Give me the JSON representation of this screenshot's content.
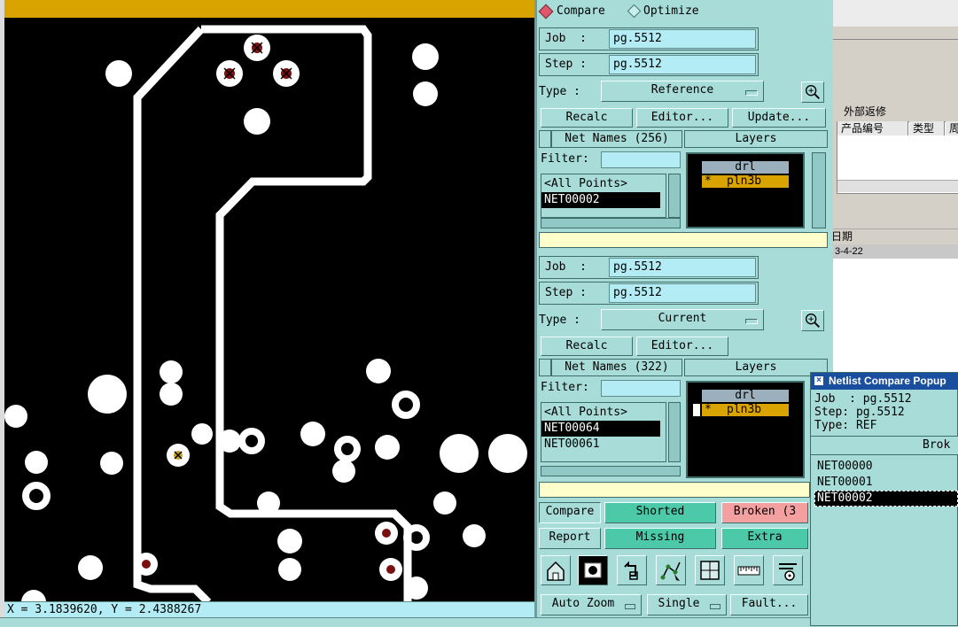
{
  "canvas": {
    "top_bar_color": "#d9a400",
    "coord_readout": "X = 3.1839620, Y = 2.4388267"
  },
  "mode": {
    "options": [
      "Compare",
      "Optimize"
    ],
    "selected": "Compare"
  },
  "reference": {
    "job_label": "Job  :",
    "job_value": "pg.5512",
    "step_label": "Step :",
    "step_value": "pg.5512",
    "type_label": "Type :",
    "type_value": "Reference",
    "buttons": [
      "Recalc",
      "Editor...",
      "Update..."
    ],
    "net_names_header": "Net Names (256)",
    "layers_header": "Layers",
    "filter_label": "Filter:",
    "filter_value": "",
    "net_list": [
      "<All Points>",
      "NET00002"
    ],
    "net_selected_index": 1,
    "layers": [
      {
        "mark": "",
        "name": "drl"
      },
      {
        "mark": "*",
        "name": "pln3b"
      }
    ]
  },
  "current": {
    "job_label": "Job  :",
    "job_value": "pg.5512",
    "step_label": "Step :",
    "step_value": "pg.5512",
    "type_label": "Type :",
    "type_value": "Current",
    "buttons": [
      "Recalc",
      "Editor..."
    ],
    "net_names_header": "Net Names (322)",
    "layers_header": "Layers",
    "filter_label": "Filter:",
    "filter_value": "",
    "net_list": [
      "<All Points>",
      "NET00064",
      "NET00061"
    ],
    "net_selected_index": 1,
    "layers": [
      {
        "mark": "",
        "name": "drl"
      },
      {
        "mark": "*",
        "name": "pln3b"
      }
    ]
  },
  "actions": {
    "compare": "Compare",
    "report": "Report",
    "shorted": "Shorted",
    "broken": "Broken (3",
    "missing": "Missing",
    "extra": "Extra",
    "colors": {
      "shorted": "#4cc9a8",
      "broken": "#f5a0a0",
      "missing": "#4cc9a8",
      "extra": "#4cc9a8"
    }
  },
  "toolbar_icons": [
    "home-icon",
    "camera-icon",
    "undo-icon",
    "route-select-icon",
    "window-icon",
    "ruler-icon",
    "settings-tools-icon"
  ],
  "bottom_controls": {
    "zoom": "Auto Zoom",
    "single": "Single",
    "fault": "Fault..."
  },
  "popup": {
    "title": "Netlist Compare Popup",
    "job_line": "Job  : pg.5512",
    "step_line": "Step: pg.5512",
    "type_line": "Type: REF",
    "column_header": "Brok",
    "items": [
      "NET00000",
      "NET00001",
      "NET00002"
    ],
    "selected_index": 2
  },
  "background_window": {
    "group_label": "外部返修",
    "columns": [
      "产品编号",
      "类型",
      "周"
    ],
    "date_header": "期",
    "date_prefix": "日期",
    "date_value": "3-4-22"
  }
}
